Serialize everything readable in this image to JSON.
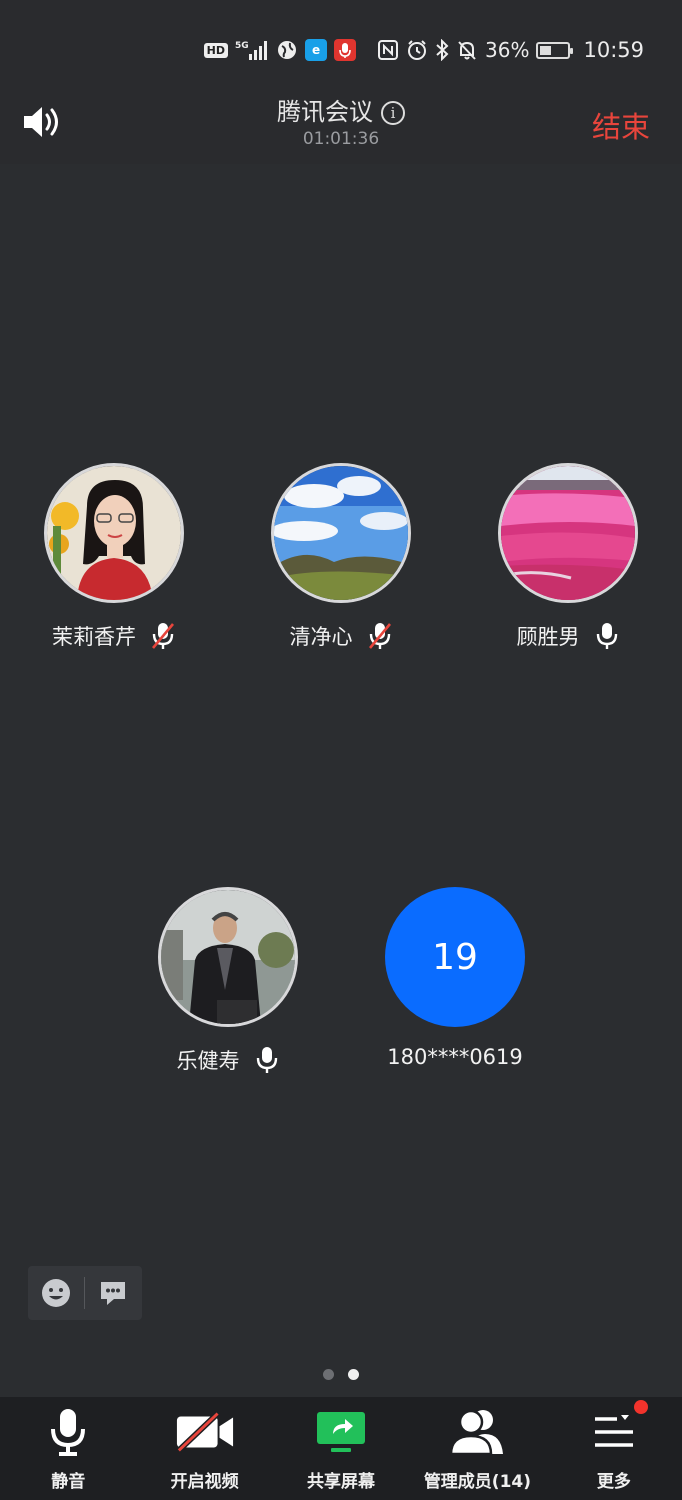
{
  "status_bar": {
    "hd": "HD",
    "network": "5G",
    "battery_percent": "36%",
    "battery_level": 0.36,
    "time": "10:59",
    "icons": [
      "hd-icon",
      "signal-5g-icon",
      "globe-icon",
      "app-notification-icon",
      "recording-mic-icon",
      "nfc-icon",
      "alarm-icon",
      "bluetooth-icon",
      "mute-bell-icon",
      "battery-icon"
    ]
  },
  "header": {
    "title": "腾讯会议",
    "duration": "01:01:36",
    "end_label": "结束"
  },
  "participants": [
    {
      "name": "茉莉香芹",
      "mic": "muted",
      "avatar": "photo-portrait"
    },
    {
      "name": "清净心",
      "mic": "muted",
      "avatar": "photo-landscape-sky"
    },
    {
      "name": "顾胜男",
      "mic": "on",
      "avatar": "photo-pink-flower-field"
    },
    {
      "name": "乐健寿",
      "mic": "on",
      "avatar": "photo-man-outdoor"
    },
    {
      "name": "180****0619",
      "mic": "none",
      "avatar_text": "19",
      "avatar_color": "#0a6cff"
    }
  ],
  "pagination": {
    "pages": 2,
    "current": 2
  },
  "toolbar": {
    "mute_label": "静音",
    "video_label": "开启视频",
    "share_label": "共享屏幕",
    "members_label": "管理成员(14)",
    "more_label": "更多"
  },
  "colors": {
    "end": "#e8453c",
    "accent_blue": "#0a6cff",
    "share_green": "#22c05a",
    "badge_red": "#f2332c"
  }
}
